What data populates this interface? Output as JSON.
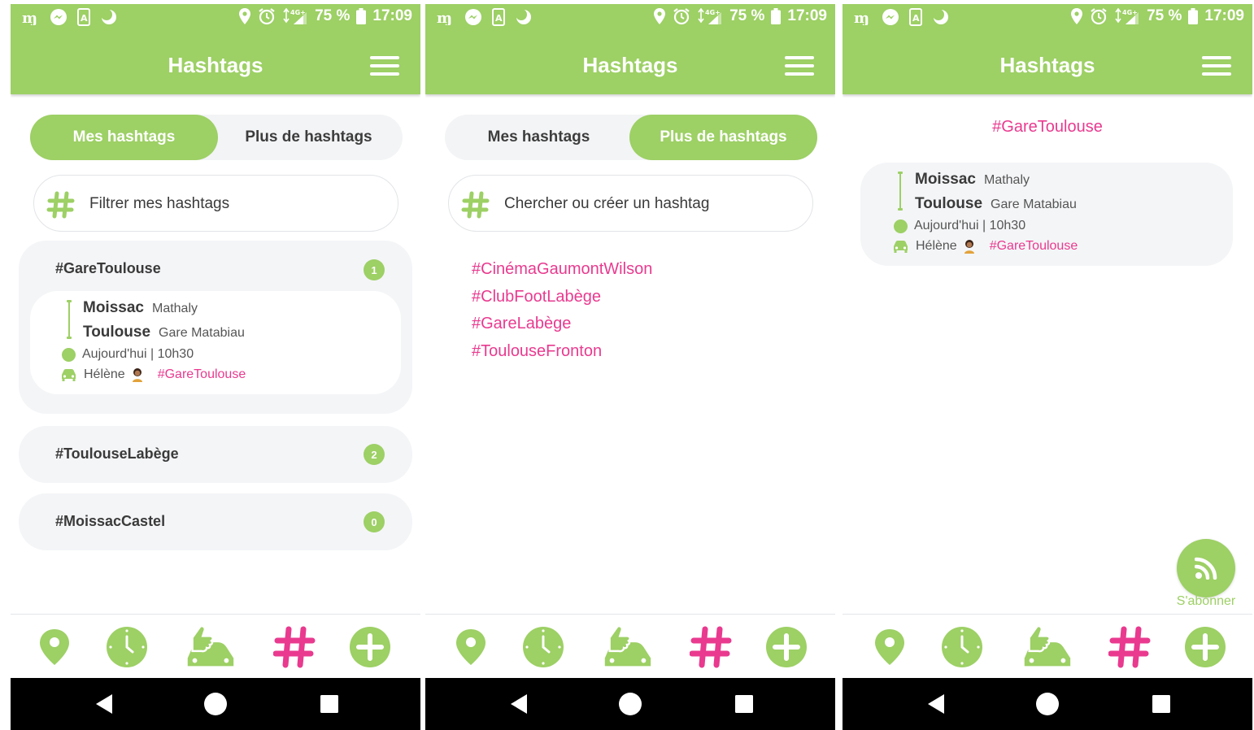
{
  "status_bar": {
    "battery": "75 %",
    "time": "17:09",
    "network": "4G+"
  },
  "app_title": "Hashtags",
  "tabs": {
    "mine": "Mes hashtags",
    "more": "Plus de hashtags"
  },
  "screen1": {
    "search_placeholder": "Filtrer mes hashtags",
    "groups": [
      {
        "tag": "#GareToulouse",
        "count": "1"
      },
      {
        "tag": "#ToulouseLabège",
        "count": "2"
      },
      {
        "tag": "#MoissacCastel",
        "count": "0"
      }
    ]
  },
  "screen2": {
    "search_placeholder": "Chercher ou créer un hashtag",
    "suggestions": [
      "#CinémaGaumontWilson",
      "#ClubFootLabège",
      "#GareLabège",
      "#ToulouseFronton"
    ]
  },
  "screen3": {
    "hashtag": "#GareToulouse",
    "subscribe_label": "S'abonner"
  },
  "ride": {
    "from_city": "Moissac",
    "from_place": "Mathaly",
    "to_city": "Toulouse",
    "to_place": "Gare Matabiau",
    "when": "Aujourd'hui | 10h30",
    "driver": "Hélène",
    "tag": "#GareToulouse"
  },
  "colors": {
    "primary": "#9dd065",
    "accent": "#e93a8f",
    "surface": "#f4f5f7"
  },
  "bottom_nav_icons": [
    "map-pin-icon",
    "clock-icon",
    "hitchhike-car-icon",
    "hashtag-icon",
    "plus-circle-icon"
  ],
  "system_nav_icons": [
    "back-icon",
    "home-icon",
    "recents-icon"
  ]
}
